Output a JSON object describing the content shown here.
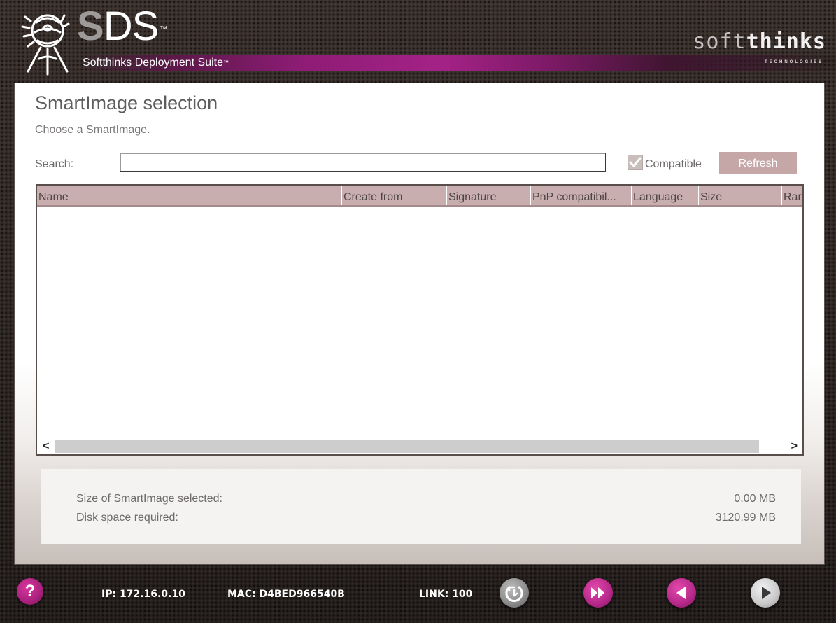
{
  "header": {
    "logo_s": "S",
    "logo_ds": "DS",
    "logo_tm": "™",
    "subtitle": "Softthinks Deployment Suite",
    "subtitle_tm": "™",
    "brand_soft": "soft",
    "brand_thinks": "thinks",
    "brand_tagline": "TECHNOLOGIES"
  },
  "page": {
    "title": "SmartImage selection",
    "subtitle": "Choose a SmartImage."
  },
  "search": {
    "label": "Search:",
    "value": "",
    "placeholder": "",
    "compatible_label": "Compatible",
    "compatible_checked": true,
    "refresh_label": "Refresh"
  },
  "grid": {
    "columns": [
      "Name",
      "Create from",
      "Signature",
      "PnP compatibil...",
      "Language",
      "Size",
      "Rar"
    ],
    "rows": []
  },
  "scrollbar": {
    "left": "<",
    "right": ">"
  },
  "summary": {
    "size_label": "Size of SmartImage selected:",
    "size_value": "0.00 MB",
    "disk_label": "Disk space required:",
    "disk_value": "3120.99 MB"
  },
  "footer": {
    "help": "?",
    "ip": "IP: 172.16.0.10",
    "mac": "MAC: D4BED966540B",
    "link": "LINK: 100",
    "buttons": [
      "shutdown-icon",
      "fast-forward-icon",
      "back-icon",
      "next-icon"
    ]
  },
  "colors": {
    "accent_pink": "#a42287",
    "header_row": "#c8aeae",
    "refresh_button": "#c4a7a6"
  }
}
